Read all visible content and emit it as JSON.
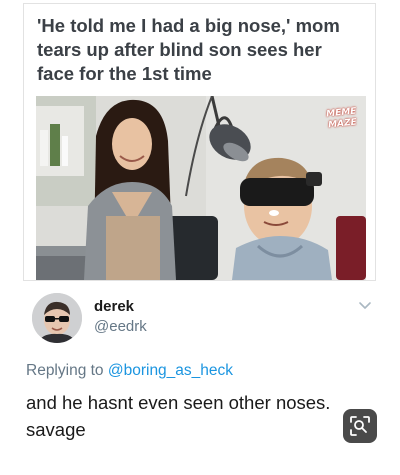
{
  "headline": {
    "line1": "'He told me I had a big nose,' mom",
    "line2": "tears up after blind son sees her",
    "line3": "face for the 1st time"
  },
  "photo": {
    "watermark_line1": "MEME",
    "watermark_line2": "MAZE"
  },
  "tweet": {
    "name": "derek",
    "handle": "@eedrk",
    "reply_prefix": "Replying to ",
    "reply_to": "@boring_as_heck",
    "text_line1": "and he hasnt even seen other noses.",
    "text_line2": "savage"
  },
  "icons": {
    "chevron": "chevron-down-icon",
    "lens": "visual-search-icon"
  },
  "colors": {
    "headline": "#3b4046",
    "secondary_text": "#657786",
    "link": "#1b95e0",
    "watermark_outline": "#c0392b"
  }
}
